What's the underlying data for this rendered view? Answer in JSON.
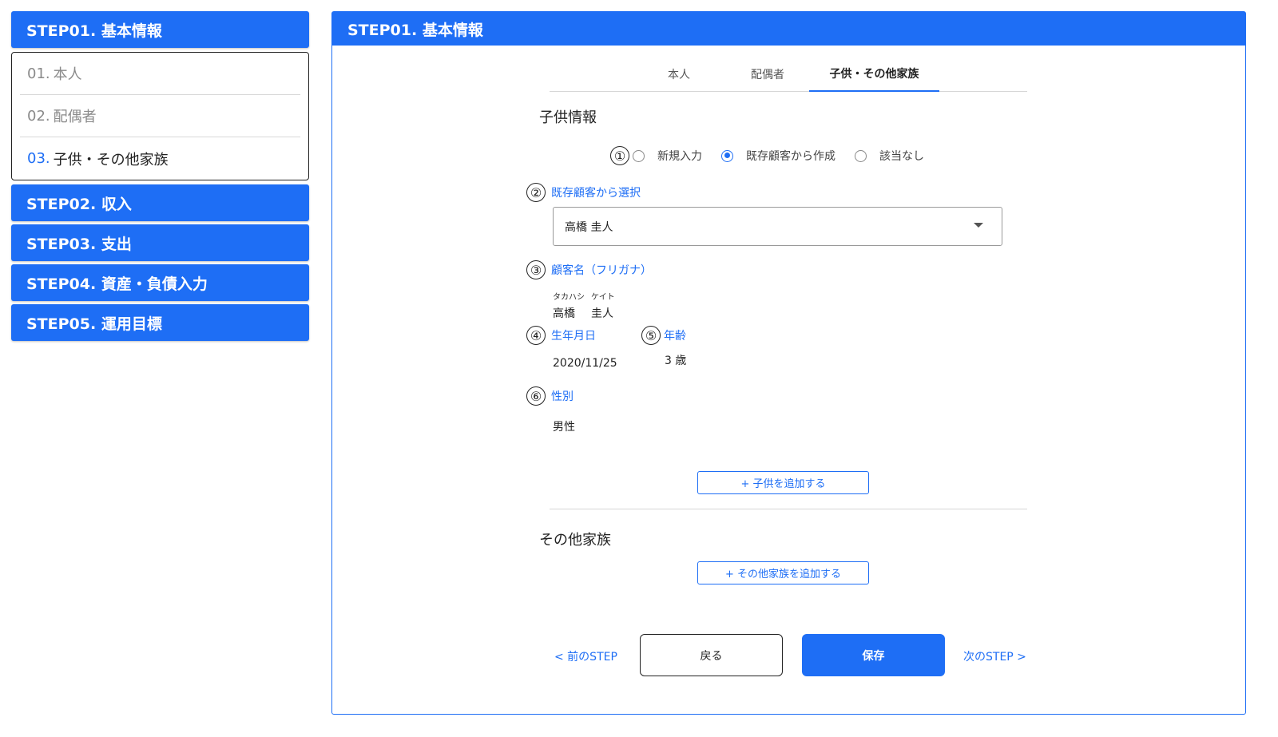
{
  "sidebar": {
    "step1": "STEP01. 基本情報",
    "substeps": [
      {
        "num": "01.",
        "label": "本人"
      },
      {
        "num": "02.",
        "label": "配偶者"
      },
      {
        "num": "03.",
        "label": "子供・その他家族"
      }
    ],
    "step2": "STEP02. 収入",
    "step3": "STEP03. 支出",
    "step4": "STEP04. 資産・負債入力",
    "step5": "STEP05. 運用目標"
  },
  "panel": {
    "title": "STEP01. 基本情報",
    "tabs": [
      "本人",
      "配偶者",
      "子供・その他家族"
    ],
    "active_tab": "子供・その他家族"
  },
  "children": {
    "section_title": "子供情報",
    "markers": [
      "①",
      "②",
      "③",
      "④",
      "⑤",
      "⑥"
    ],
    "radio_options": [
      "新規入力",
      "既存顧客から作成",
      "該当なし"
    ],
    "radio_selected": "既存顧客から作成",
    "select_label": "既存顧客から選択",
    "select_value": "高橋 圭人",
    "name_label": "顧客名（フリガナ）",
    "kana_last": "タカハシ",
    "kana_first": "ケイト",
    "name_last": "高橋",
    "name_first": "圭人",
    "birth_label": "生年月日",
    "birth_value": "2020/11/25",
    "age_label": "年齢",
    "age_value": "3 歳",
    "gender_label": "性別",
    "gender_value": "男性",
    "add_child_button": "+ 子供を追加する"
  },
  "others": {
    "section_title": "その他家族",
    "add_other_button": "+ その他家族を追加する"
  },
  "footer": {
    "prev_step": "< 前のSTEP",
    "back": "戻る",
    "save": "保存",
    "next_step": "次のSTEP >"
  },
  "colors": {
    "accent": "#1e6ef5"
  }
}
